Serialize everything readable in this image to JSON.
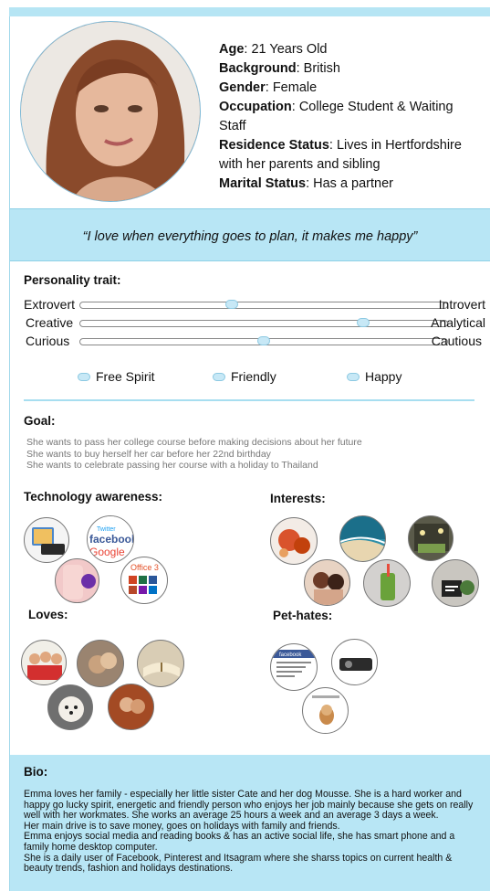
{
  "profile": {
    "age_label": "Age",
    "age_value": ": 21 Years Old",
    "background_label": "Background",
    "background_value": ": British",
    "gender_label": "Gender",
    "gender_value": ": Female",
    "occupation_label": "Occupation",
    "occupation_value": ": College Student & Waiting Staff",
    "residence_label": "Residence Status",
    "residence_value": ": Lives in Hertfordshire with her parents and sibling",
    "marital_label": "Marital Status",
    "marital_value": ": Has a partner"
  },
  "quote": "“I love when everything goes to plan, it makes me happy”",
  "personality": {
    "title": "Personality trait:",
    "traits": [
      {
        "left": "Extrovert",
        "right": "Introvert",
        "level": 0.41
      },
      {
        "left": "Creative",
        "right": "Analytical",
        "level": 0.78
      },
      {
        "left": "Curious",
        "right": "Cautious",
        "level": 0.5
      }
    ],
    "chips": [
      "Free Spirit",
      "Friendly",
      "Happy"
    ]
  },
  "goal": {
    "title": "Goal:",
    "items": [
      "She wants to pass her college course before making decisions about her future",
      "She wants to buy herself her car before her 22nd birthday",
      "She wants to celebrate passing her course with a holiday to Thailand"
    ]
  },
  "technology": {
    "title": "Technology awareness:",
    "icons": [
      "tablet-keyboard-icon",
      "social-media-logos-icon",
      "smartphone-icon",
      "office-apps-icon"
    ],
    "labels": [
      "Twitter",
      "facebook",
      "Google",
      "Office 3"
    ]
  },
  "interests": {
    "title": "Interests:",
    "icons": [
      "food-icon",
      "beach-icon",
      "cafe-icon",
      "friends-icon",
      "smoothie-icon",
      "plants-icon"
    ]
  },
  "loves": {
    "title": "Loves:",
    "icons": [
      "family-icon",
      "friends-photo-icon",
      "book-icon",
      "dog-icon",
      "couple-icon"
    ]
  },
  "pethates": {
    "title": "Pet-hates:",
    "icons": [
      "facebook-post-icon",
      "projector-icon",
      "dog-card-icon"
    ],
    "facebook_label": "facebook"
  },
  "bio": {
    "title": "Bio:",
    "paragraphs": [
      "Emma loves her family - especially her little sister Cate and her dog Mousse. She is a hard worker and happy go lucky spirit, energetic and friendly person who enjoys her job mainly because she gets on really well with her workmates. She works an average 25 hours a week and an average 3 days a week.",
      "Her main drive is to save money, goes on holidays with family and friends.",
      "Emma enjoys social media and reading books & has an active social life, she has smart phone and a family home desktop computer.",
      "She is a daily user of Facebook, Pinterest and Itsagram where she sharss topics on current health & beauty trends, fashion and holidays destinations."
    ]
  },
  "colors": {
    "accent": "#b8e6f5",
    "knob": "#c7e8f6",
    "goal_text": "#777777"
  }
}
